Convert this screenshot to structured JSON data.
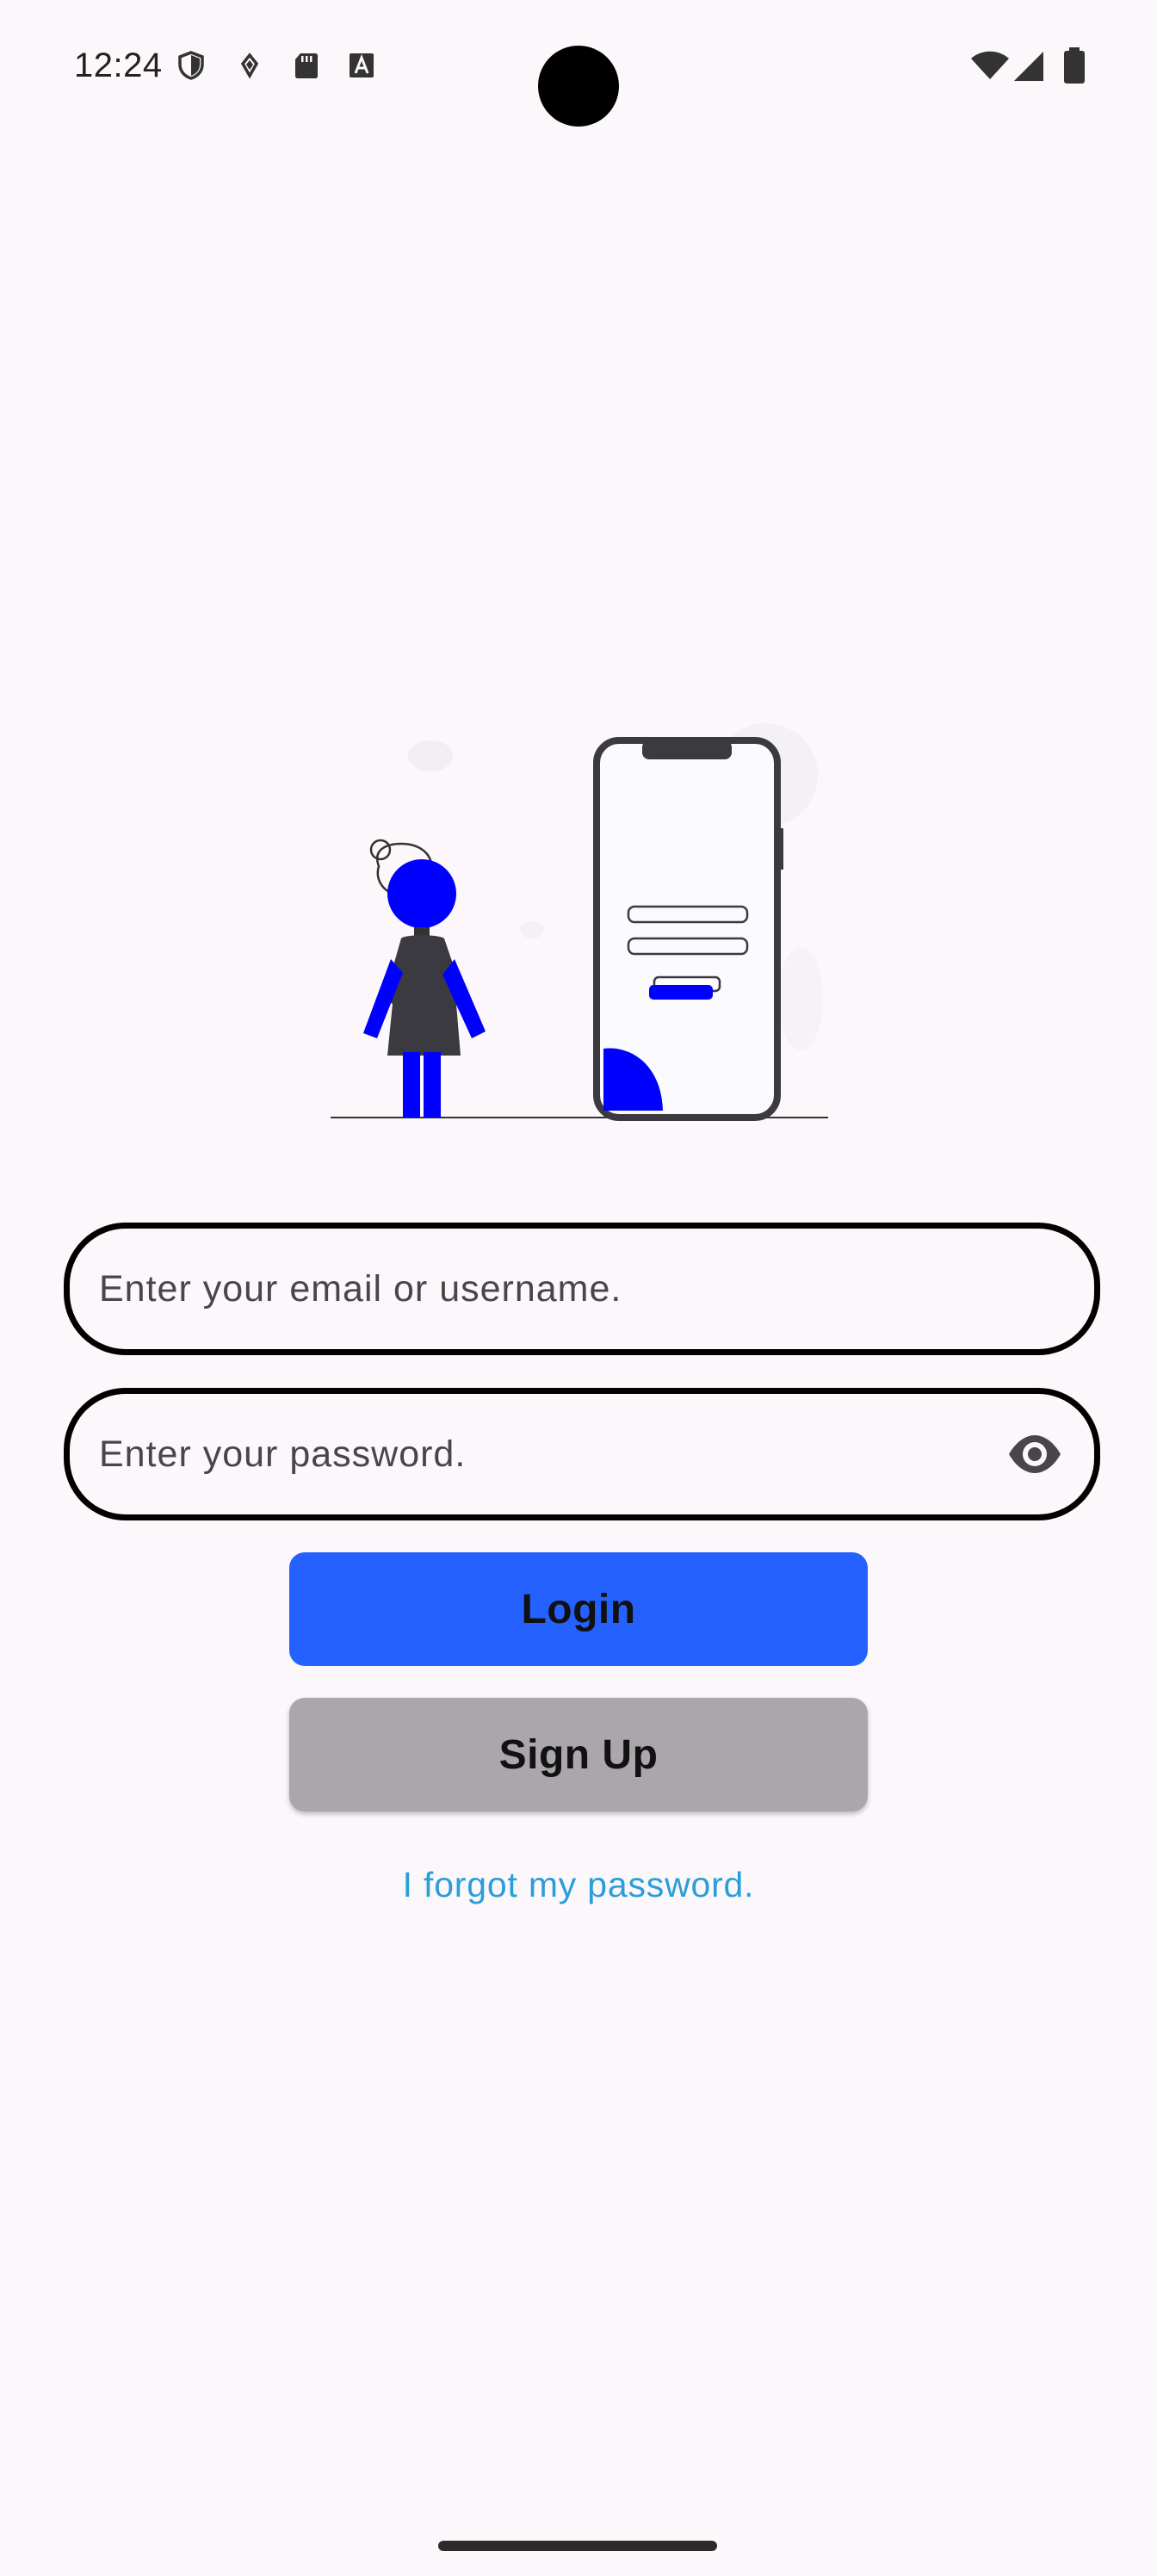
{
  "status_bar": {
    "time": "12:24",
    "left_icons": [
      "shield-icon",
      "location-drop-icon",
      "sd-card-icon",
      "text-a-icon"
    ],
    "right_icons": [
      "wifi-icon",
      "cellular-signal-icon",
      "battery-icon"
    ]
  },
  "illustration": {
    "icon": "person-with-phone-login-illustration",
    "accent_color": "#0000ff"
  },
  "login_form": {
    "email_placeholder": "Enter your email or username.",
    "email_value": "",
    "password_placeholder": "Enter your password.",
    "password_value": "",
    "password_toggle_icon": "eye-icon",
    "login_label": "Login",
    "signup_label": "Sign Up",
    "forgot_label": "I forgot my password."
  },
  "colors": {
    "login_button": "#2461ff",
    "signup_button": "#aaa6ab",
    "link": "#2a9ed8",
    "background": "#fbf7fa"
  }
}
